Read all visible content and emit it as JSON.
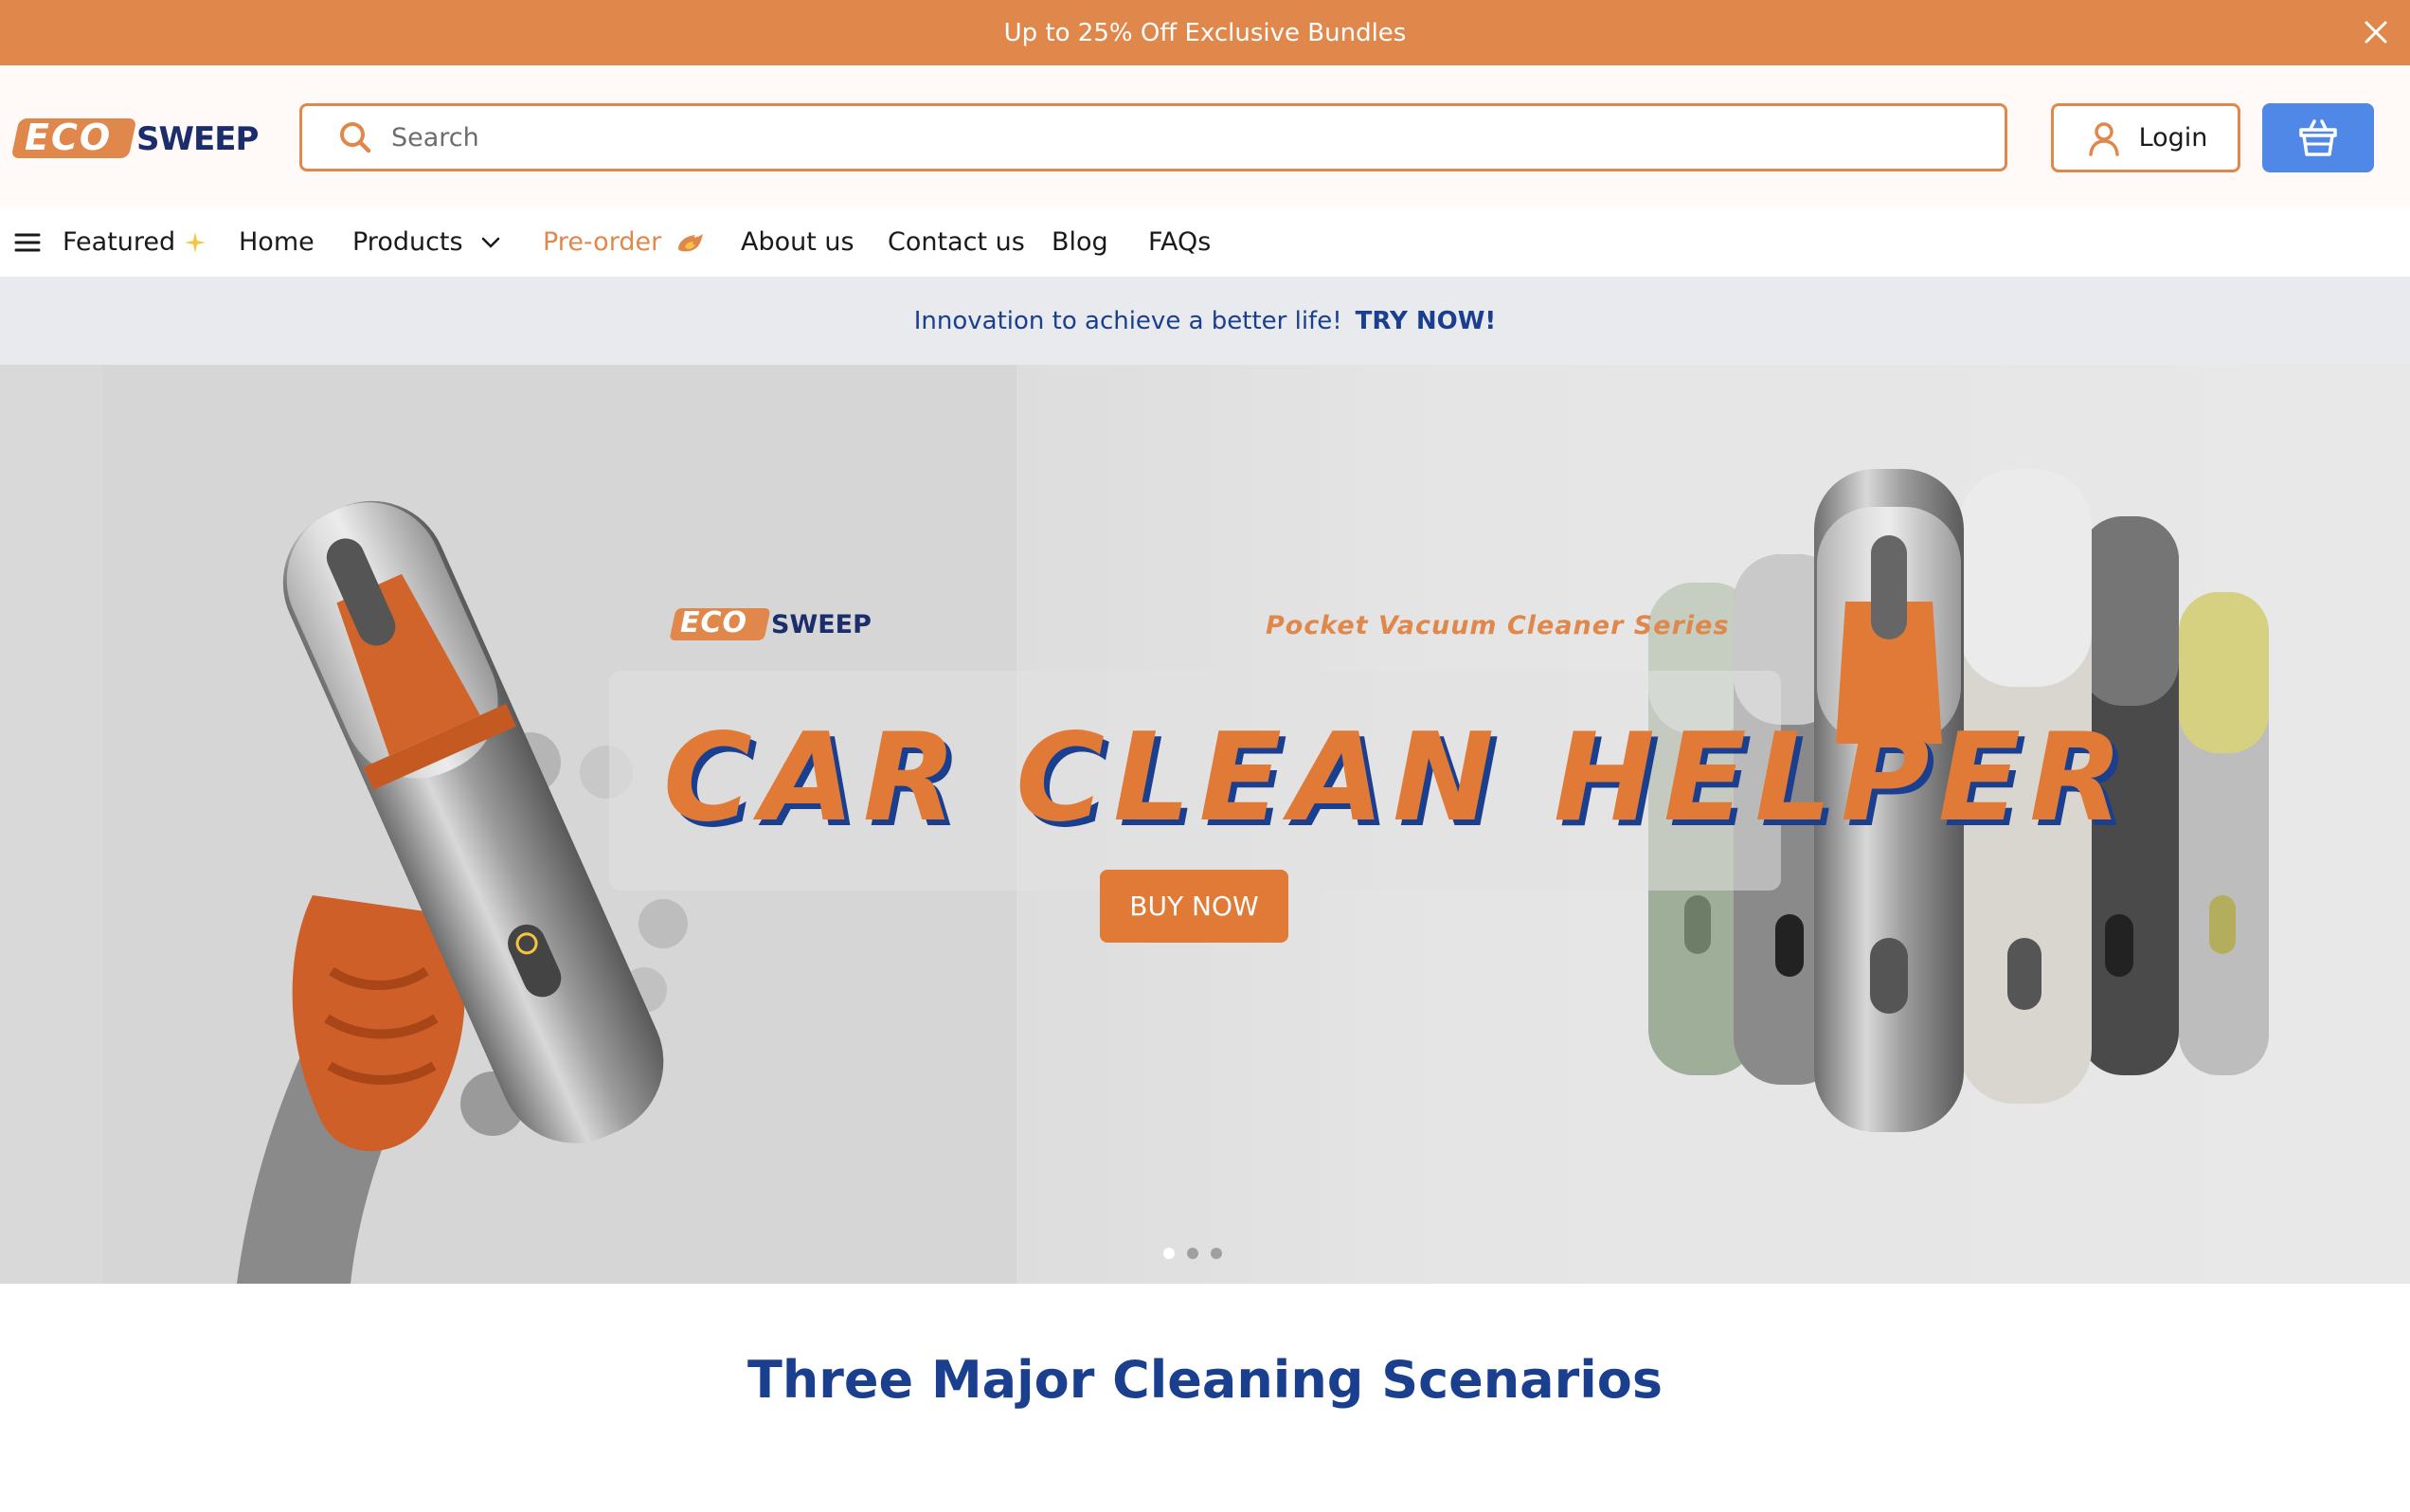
{
  "announcement": {
    "text": "Up to 25% Off Exclusive Bundles"
  },
  "header": {
    "logo": {
      "eco": "ECO",
      "sweep": "SWEEP"
    },
    "search": {
      "placeholder": "Search"
    },
    "login_label": "Login"
  },
  "nav": {
    "items": [
      {
        "label": "Featured"
      },
      {
        "label": "Home"
      },
      {
        "label": "Products"
      },
      {
        "label": "Pre-order"
      },
      {
        "label": "About us"
      },
      {
        "label": "Contact us"
      },
      {
        "label": "Blog"
      },
      {
        "label": "FAQs"
      }
    ]
  },
  "promo": {
    "text": "Innovation to achieve a better life!",
    "link": "TRY NOW!"
  },
  "hero": {
    "brand": {
      "eco": "ECO",
      "sweep": "SWEEP"
    },
    "series": "Pocket Vacuum Cleaner Series",
    "headline": "CAR CLEAN HELPER",
    "button": "BUY NOW",
    "slides": 3,
    "active_slide": 1
  },
  "section": {
    "title": "Three Major Cleaning Scenarios"
  },
  "colors": {
    "accent": "#e0884b",
    "navy": "#1b3f8f",
    "cart": "#4f88e6"
  },
  "icons": [
    "close-icon",
    "search-icon",
    "user-icon",
    "basket-icon",
    "menu-icon",
    "sparkle-icon",
    "chevron-down-icon",
    "fire-icon"
  ]
}
